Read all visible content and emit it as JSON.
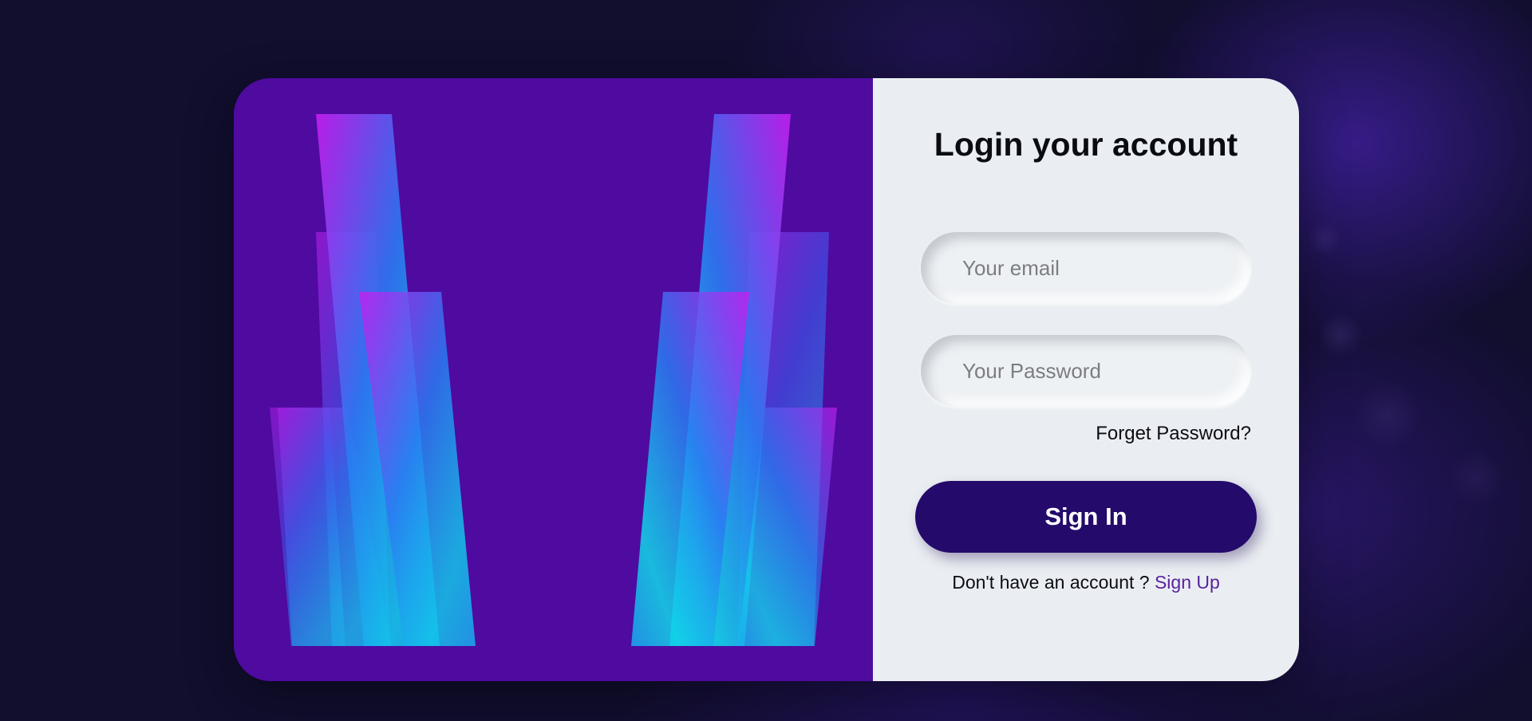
{
  "login": {
    "title": "Login your account",
    "email_placeholder": "Your email",
    "password_placeholder": "Your Password",
    "forgot_label": "Forget Password?",
    "signin_label": "Sign In",
    "no_account_text": "Don't have an account ? ",
    "signup_label": "Sign Up"
  },
  "colors": {
    "page_background": "#110e2e",
    "art_panel": "#4f0aa0",
    "form_panel": "#eaeef2",
    "button": "#240a6a",
    "link": "#5a22a0",
    "gradient_magenta": "#c41ff0",
    "gradient_blue": "#1a6cf0",
    "gradient_cyan": "#10d8e8"
  }
}
